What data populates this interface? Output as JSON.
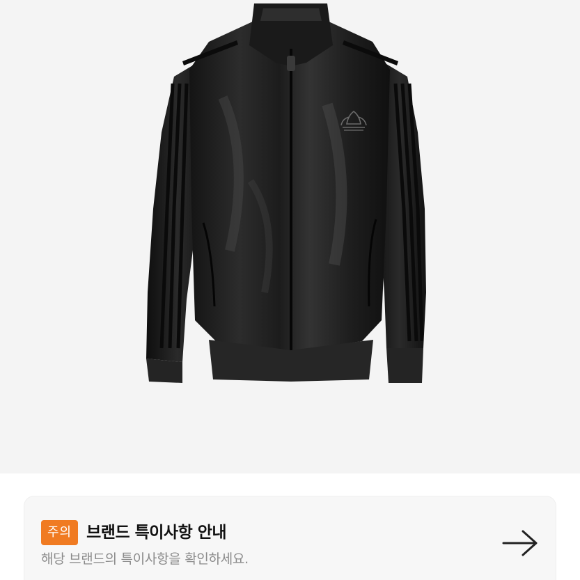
{
  "product": {
    "image_alt": "black shiny track jacket with trefoil logo"
  },
  "notice": {
    "badge": "주의",
    "title": "브랜드 특이사항 안내",
    "subtitle": "해당 브랜드의 특이사항을 확인하세요.",
    "arrow_icon": "arrow-right-icon"
  },
  "colors": {
    "badge_bg": "#f07b22",
    "card_bg": "#f7f7f7",
    "title_text": "#111111",
    "subtitle_text": "#8a8a8a",
    "image_bg": "#f4f4f4"
  }
}
